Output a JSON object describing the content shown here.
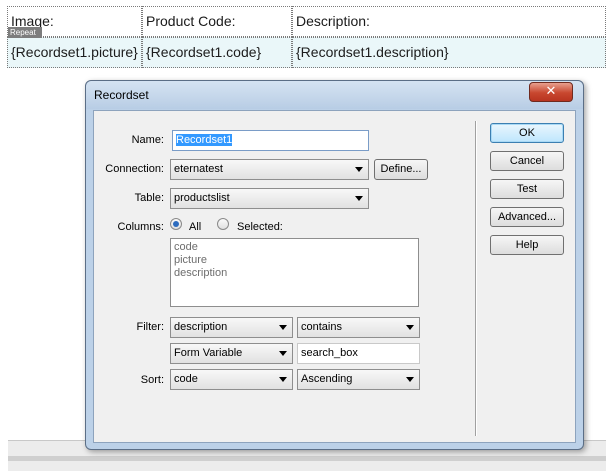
{
  "design_view": {
    "headers": [
      "Image:",
      "Product Code:",
      "Description:"
    ],
    "cells": [
      "{Recordset1.picture}",
      "{Recordset1.code}",
      "{Recordset1.description}"
    ],
    "repeat_tag": "Repeat"
  },
  "dialog": {
    "title": "Recordset",
    "close_label": "✕",
    "name_label": "Name:",
    "name_value": "Recordset1",
    "connection_label": "Connection:",
    "connection_value": "eternatest",
    "define_label": "Define...",
    "table_label": "Table:",
    "table_value": "productslist",
    "columns_label": "Columns:",
    "all_label": "All",
    "selected_label": "Selected:",
    "column_items": [
      "code",
      "picture",
      "description"
    ],
    "filter_label": "Filter:",
    "filter_column": "description",
    "filter_operator": "contains",
    "filter_source": "Form Variable",
    "filter_value": "search_box",
    "sort_label": "Sort:",
    "sort_column": "code",
    "sort_order": "Ascending",
    "buttons": {
      "ok": "OK",
      "cancel": "Cancel",
      "test": "Test",
      "advanced": "Advanced...",
      "help": "Help"
    }
  },
  "colors": {
    "dynamic_cell_bg": "#eaf7f9",
    "dialog_frame": "#bcd1e8",
    "close_button": "#c8472f"
  }
}
